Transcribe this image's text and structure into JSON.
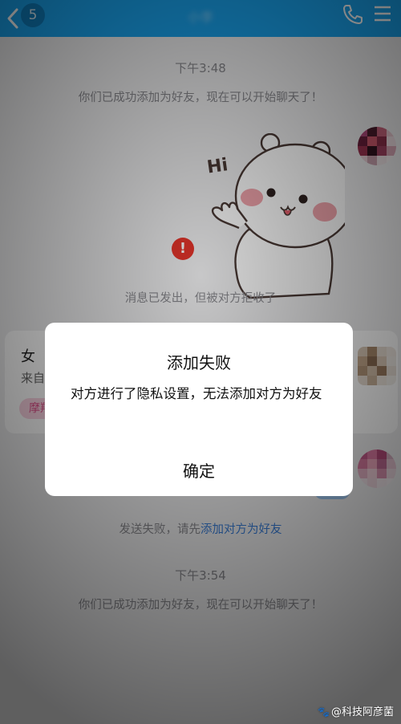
{
  "header": {
    "back_count": "5",
    "title": "小李",
    "icons": [
      "back-chevron-icon",
      "phone-icon",
      "menu-icon"
    ]
  },
  "messages": {
    "time_1": "下午3:48",
    "added_friend_1": "你们已成功添加为好友，现在可以开始聊天了！",
    "sticker_text": "Hi",
    "rejected_notice": "消息已发出，但被对方拒收了",
    "send_failed_prefix": "发送失败，请先",
    "send_failed_link": "添加对方为好友",
    "time_2": "下午3:54",
    "added_friend_2": "你们已成功添加为好友，现在可以开始聊天了！"
  },
  "profile_card": {
    "gender": "女",
    "from_prefix": "来自",
    "tag": "摩羯座"
  },
  "dialog": {
    "title": "添加失败",
    "message": "对方进行了隐私设置，无法添加对方为好友",
    "confirm": "确定"
  },
  "watermark": {
    "text": "@科技阿彦菌"
  },
  "colors": {
    "header_bg": "#1aa4f0",
    "link": "#3b7fd9",
    "error": "#e5352b"
  }
}
